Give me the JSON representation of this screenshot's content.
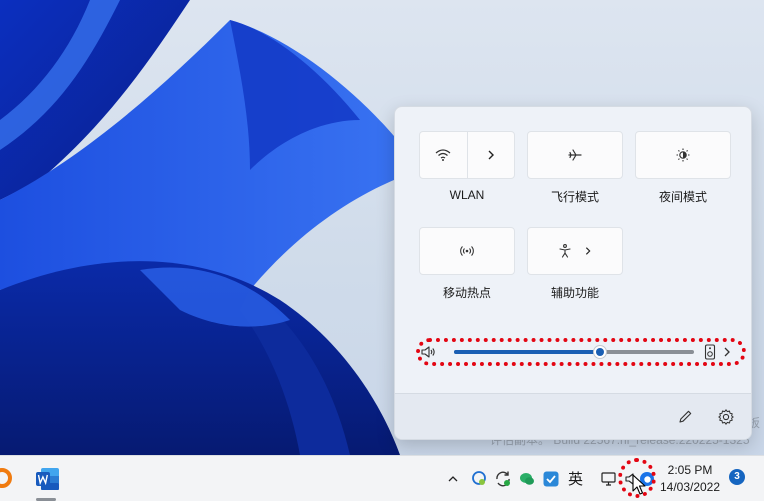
{
  "quick_settings": {
    "tiles": [
      {
        "label": "WLAN",
        "icon": "wifi-icon",
        "secondary_icon": "chevron-right-icon"
      },
      {
        "label": "飞行模式",
        "icon": "airplane-icon"
      },
      {
        "label": "夜间模式",
        "icon": "night-light-icon"
      },
      {
        "label": "移动热点",
        "icon": "hotspot-icon"
      },
      {
        "label": "辅助功能",
        "icon": "accessibility-icon",
        "secondary_icon": "chevron-right-icon"
      }
    ],
    "volume": {
      "level": 0.61,
      "icon": "volume-icon",
      "output_icon": "speaker-device-icon",
      "more_icon": "chevron-right-icon"
    },
    "footer": {
      "edit_icon": "pencil-icon",
      "settings_icon": "gear-icon"
    },
    "highlight_color": "#e30613",
    "accent": "#1a5fb4"
  },
  "desktop": {
    "watermark_line": "评估副本。 Build 22567.ni_release.220225-1325",
    "watermark_edge": "板"
  },
  "taskbar": {
    "time": "2:05 PM",
    "date": "14/03/2022",
    "notification_count": "3",
    "ime_label": "英",
    "tray_icons": [
      "chevron-up-icon",
      "chat-icon",
      "sync-icon",
      "wechat-icon",
      "security-icon",
      "network-icon",
      "volume-icon",
      "edge-icon"
    ],
    "pinned_apps": [
      "app-orange-icon",
      "word-icon"
    ]
  }
}
